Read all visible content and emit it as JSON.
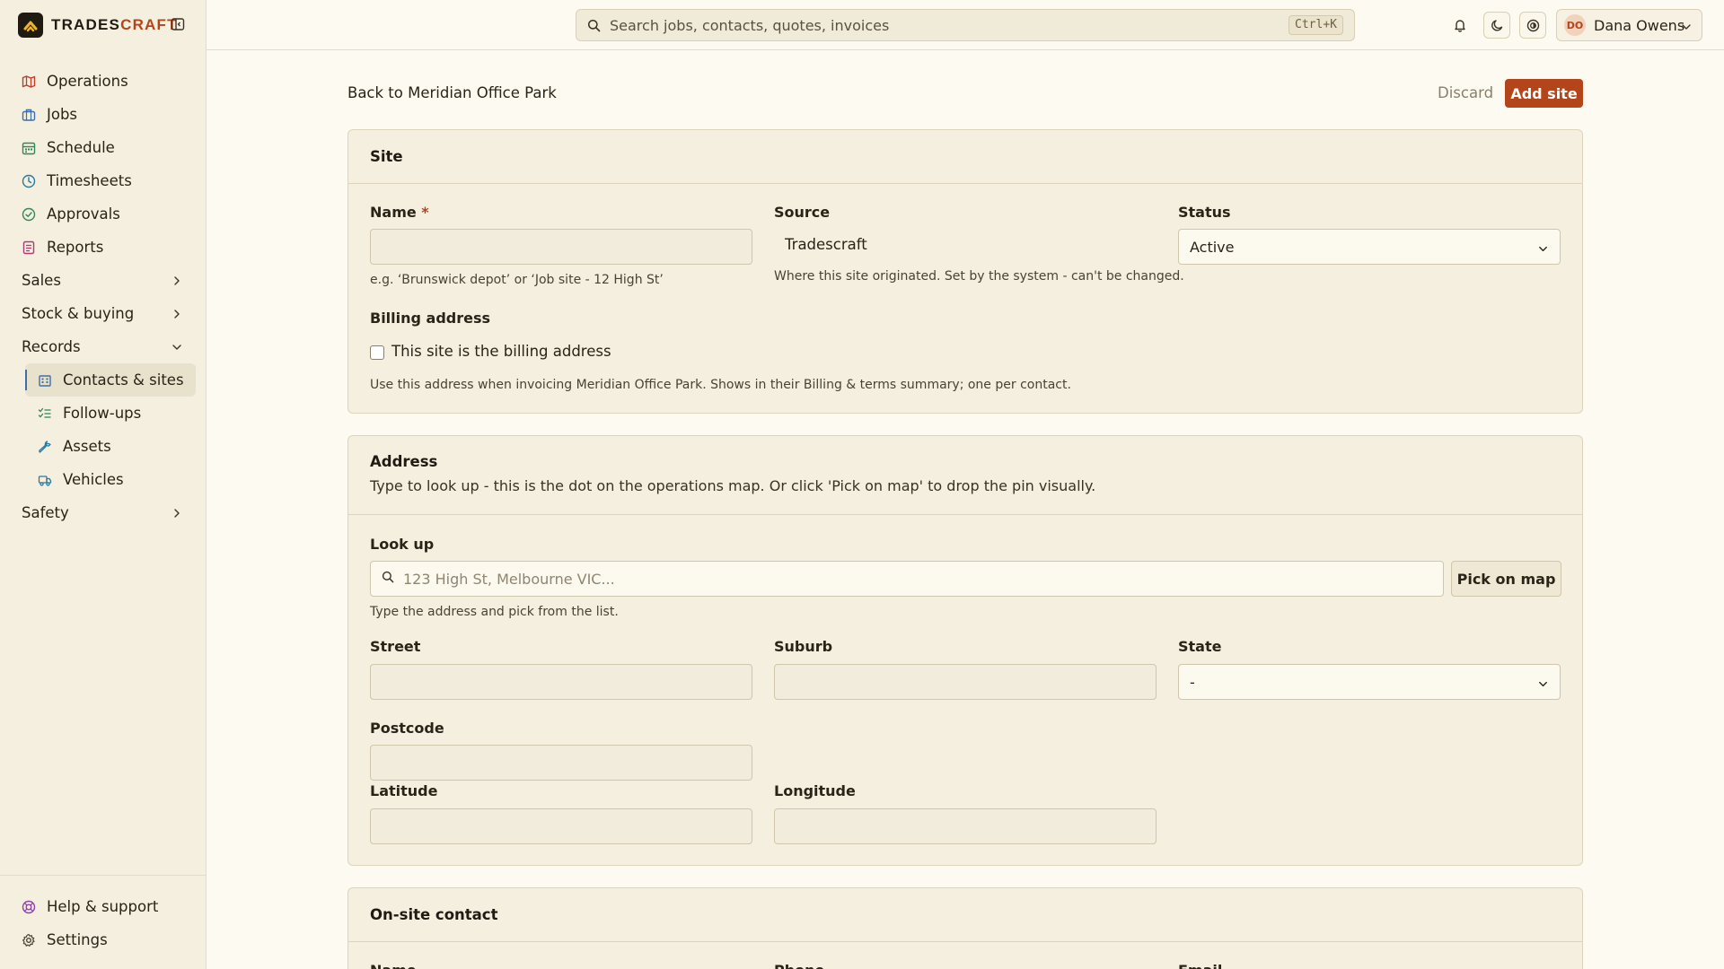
{
  "brand": {
    "name_part1": "TRADES",
    "name_part2": "CRAFT"
  },
  "sidebar": {
    "items": [
      {
        "label": "Operations",
        "icon": "map-icon",
        "color": "#c0392b"
      },
      {
        "label": "Jobs",
        "icon": "briefcase-icon",
        "color": "#3f6fa8"
      },
      {
        "label": "Schedule",
        "icon": "calendar-icon",
        "color": "#2e8b57"
      },
      {
        "label": "Timesheets",
        "icon": "clock-icon",
        "color": "#2b7a9b"
      },
      {
        "label": "Approvals",
        "icon": "check-circle-icon",
        "color": "#2e8b57"
      },
      {
        "label": "Reports",
        "icon": "report-icon",
        "color": "#b03a74"
      }
    ],
    "groups": {
      "sales": "Sales",
      "stock": "Stock & buying",
      "records": "Records",
      "safety": "Safety"
    },
    "records_items": [
      {
        "label": "Contacts & sites",
        "icon": "building-icon"
      },
      {
        "label": "Follow-ups",
        "icon": "list-check-icon"
      },
      {
        "label": "Assets",
        "icon": "wrench-icon"
      },
      {
        "label": "Vehicles",
        "icon": "truck-icon"
      }
    ],
    "bottom": {
      "help": "Help & support",
      "settings": "Settings"
    }
  },
  "topbar": {
    "search_placeholder": "Search jobs, contacts, quotes, invoices",
    "shortcut": "Ctrl+K",
    "user_initials": "DO",
    "user_name": "Dana Owens"
  },
  "page": {
    "back_label": "Back to Meridian Office Park",
    "discard_label": "Discard",
    "submit_label": "Add site"
  },
  "site_card": {
    "title": "Site",
    "name_label": "Name",
    "name_required": "*",
    "name_help": "e.g. ‘Brunswick depot’ or ‘Job site - 12 High St’",
    "source_label": "Source",
    "source_value": "Tradescraft",
    "source_help": "Where this site originated. Set by the system - can't be changed.",
    "status_label": "Status",
    "status_value": "Active",
    "billing_label": "Billing address",
    "billing_checkbox_label": "This site is the billing address",
    "billing_checked": false,
    "billing_help": "Use this address when invoicing Meridian Office Park. Shows in their Billing & terms summary; one per contact."
  },
  "address_card": {
    "title": "Address",
    "subtitle": "Type to look up - this is the dot on the operations map. Or click 'Pick on map' to drop the pin visually.",
    "lookup_label": "Look up",
    "lookup_placeholder": "123 High St, Melbourne VIC...",
    "pick_map_label": "Pick on map",
    "lookup_help": "Type the address and pick from the list.",
    "street_label": "Street",
    "suburb_label": "Suburb",
    "state_label": "State",
    "state_value": "-",
    "postcode_label": "Postcode",
    "latitude_label": "Latitude",
    "longitude_label": "Longitude"
  },
  "contact_card": {
    "title": "On-site contact",
    "name_label": "Name",
    "phone_label": "Phone",
    "email_label": "Email"
  },
  "colors": {
    "accent": "#b4441a",
    "background": "#fdfaf1",
    "sidebar": "#f4efdf"
  }
}
